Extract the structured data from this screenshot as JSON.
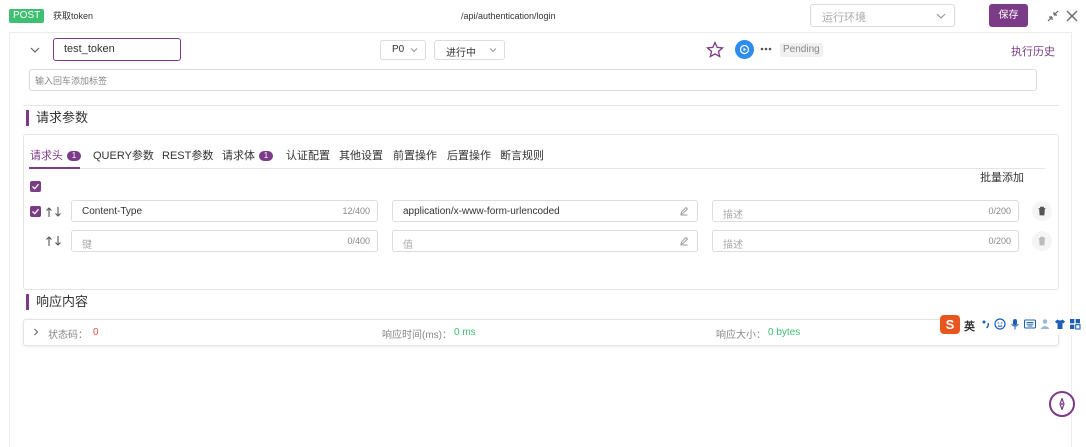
{
  "topbar": {
    "method": "POST",
    "api_name": "获取token",
    "path": "/api/authentication/login",
    "env_placeholder": "运行环境",
    "save_label": "保存"
  },
  "case": {
    "name": "test_token",
    "priority": "P0",
    "status": "进行中",
    "run_status": "Pending",
    "history_label": "执行历史",
    "tag_placeholder": "输入回车添加标签"
  },
  "request": {
    "title": "请求参数",
    "tabs": [
      {
        "label": "请求头",
        "badge": "1"
      },
      {
        "label": "QUERY参数"
      },
      {
        "label": "REST参数"
      },
      {
        "label": "请求体",
        "badge": "1"
      },
      {
        "label": "认证配置"
      },
      {
        "label": "其他设置"
      },
      {
        "label": "前置操作"
      },
      {
        "label": "后置操作"
      },
      {
        "label": "断言规则"
      }
    ],
    "batch_add_label": "批量添加",
    "rows": [
      {
        "key": "Content-Type",
        "key_count": "12/400",
        "value": "application/x-www-form-urlencoded",
        "desc_placeholder": "描述",
        "desc_count": "0/200"
      },
      {
        "key_placeholder": "键",
        "key_count": "0/400",
        "value_placeholder": "值",
        "desc_placeholder": "描述",
        "desc_count": "0/200"
      }
    ]
  },
  "response": {
    "title": "响应内容",
    "status_label": "状态码：",
    "status_value": "0",
    "time_label": "响应时间(ms)：",
    "time_value": "0 ms",
    "size_label": "响应大小：",
    "size_value": "0 bytes"
  },
  "ime": {
    "logo": "S",
    "mode": "英"
  },
  "colors": {
    "accent": "#7b3b87",
    "method_green": "#3fbf72",
    "status_red": "#e0513a",
    "value_green": "#3fbf72"
  }
}
